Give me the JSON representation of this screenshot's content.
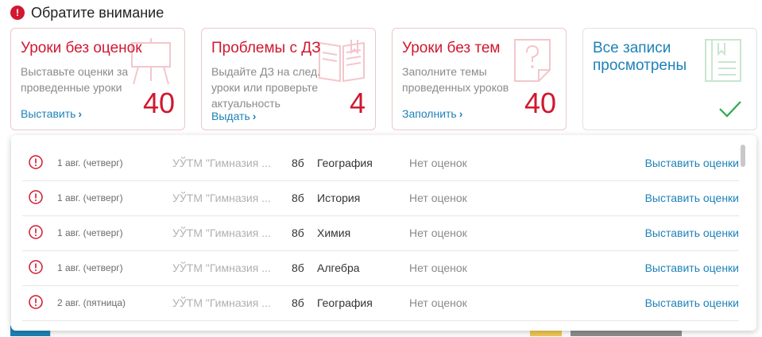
{
  "header": {
    "icon": "exclamation-icon",
    "title": "Обратите внимание"
  },
  "cards": [
    {
      "title": "Уроки без оценок",
      "desc": "Выставьте оценки за проведенные уроки",
      "count": "40",
      "link": "Выставить",
      "icon": "easel-icon"
    },
    {
      "title": "Проблемы с ДЗ",
      "desc": "Выдайте ДЗ на след. уроки или проверьте актуальность",
      "count": "4",
      "link": "Выдать",
      "icon": "open-book-icon"
    },
    {
      "title": "Уроки без тем",
      "desc": "Заполните темы проведенных уроков",
      "count": "40",
      "link": "Заполнить",
      "icon": "question-page-icon"
    },
    {
      "title": "Все записи просмотрены",
      "icon": "journal-icon",
      "status_icon": "checkmark-icon"
    }
  ],
  "rows": [
    {
      "date": "1 авг. (четверг)",
      "school": "УЎТМ \"Гимназия ...",
      "class": "8б",
      "subject": "География",
      "status": "Нет оценок",
      "action": "Выставить оценки"
    },
    {
      "date": "1 авг. (четверг)",
      "school": "УЎТМ \"Гимназия ...",
      "class": "8б",
      "subject": "История",
      "status": "Нет оценок",
      "action": "Выставить оценки"
    },
    {
      "date": "1 авг. (четверг)",
      "school": "УЎТМ \"Гимназия ...",
      "class": "8б",
      "subject": "Химия",
      "status": "Нет оценок",
      "action": "Выставить оценки"
    },
    {
      "date": "1 авг. (четверг)",
      "school": "УЎТМ \"Гимназия ...",
      "class": "8б",
      "subject": "Алгебра",
      "status": "Нет оценок",
      "action": "Выставить оценки"
    },
    {
      "date": "2 авг. (пятница)",
      "school": "УЎТМ \"Гимназия ...",
      "class": "8б",
      "subject": "География",
      "status": "Нет оценок",
      "action": "Выставить оценки"
    }
  ],
  "colors": {
    "accent_red": "#d0182f",
    "link_blue": "#1e82b8",
    "ok_green": "#2fa84f"
  }
}
